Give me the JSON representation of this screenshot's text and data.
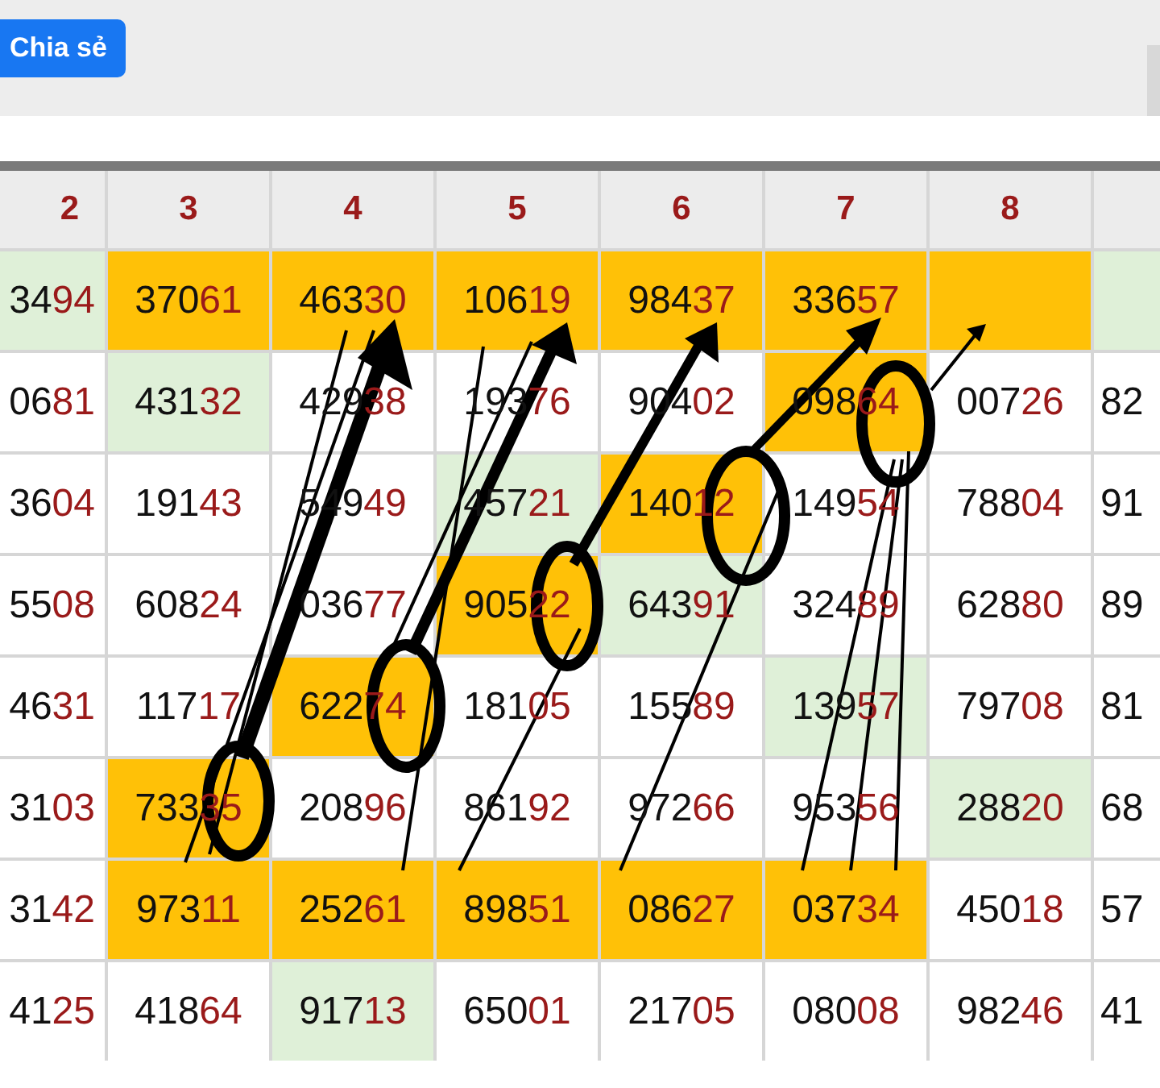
{
  "share_button": {
    "label": "Chia sẻ"
  },
  "table": {
    "columns": [
      "2",
      "3",
      "4",
      "5",
      "6",
      "7",
      "8",
      ""
    ],
    "rows": [
      [
        {
          "text": "3494",
          "color": "#dff0d8"
        },
        {
          "text": "37061",
          "color": "#ffc107"
        },
        {
          "text": "46330",
          "color": "#ffc107"
        },
        {
          "text": "10619",
          "color": "#ffc107"
        },
        {
          "text": "98437",
          "color": "#ffc107"
        },
        {
          "text": "33657",
          "color": "#ffc107"
        },
        {
          "text": "",
          "color": "#ffc107"
        },
        {
          "text": "",
          "color": "#dff0d8"
        }
      ],
      [
        {
          "text": "0681"
        },
        {
          "text": "43132",
          "color": "#dff0d8"
        },
        {
          "text": "42938"
        },
        {
          "text": "19376"
        },
        {
          "text": "90402"
        },
        {
          "text": "09864",
          "color": "#ffc107"
        },
        {
          "text": "00726"
        },
        {
          "text": "82"
        }
      ],
      [
        {
          "text": "3604"
        },
        {
          "text": "19143"
        },
        {
          "text": "54949"
        },
        {
          "text": "45721",
          "color": "#dff0d8"
        },
        {
          "text": "14012",
          "color": "#ffc107"
        },
        {
          "text": "14954"
        },
        {
          "text": "78804"
        },
        {
          "text": "91"
        }
      ],
      [
        {
          "text": "5508"
        },
        {
          "text": "60824"
        },
        {
          "text": "03677"
        },
        {
          "text": "90522",
          "color": "#ffc107"
        },
        {
          "text": "64391",
          "color": "#dff0d8"
        },
        {
          "text": "32489"
        },
        {
          "text": "62880"
        },
        {
          "text": "89"
        }
      ],
      [
        {
          "text": "4631"
        },
        {
          "text": "11717"
        },
        {
          "text": "62274",
          "color": "#ffc107"
        },
        {
          "text": "18105"
        },
        {
          "text": "15589"
        },
        {
          "text": "13957",
          "color": "#dff0d8"
        },
        {
          "text": "79708"
        },
        {
          "text": "81"
        }
      ],
      [
        {
          "text": "3103"
        },
        {
          "text": "73335",
          "color": "#ffc107"
        },
        {
          "text": "20896"
        },
        {
          "text": "86192"
        },
        {
          "text": "97266"
        },
        {
          "text": "95356"
        },
        {
          "text": "28820",
          "color": "#dff0d8"
        },
        {
          "text": "68"
        }
      ],
      [
        {
          "text": "3142"
        },
        {
          "text": "97311",
          "color": "#ffc107"
        },
        {
          "text": "25261",
          "color": "#ffc107"
        },
        {
          "text": "89851",
          "color": "#ffc107"
        },
        {
          "text": "08627",
          "color": "#ffc107"
        },
        {
          "text": "03734",
          "color": "#ffc107"
        },
        {
          "text": "45018"
        },
        {
          "text": "57"
        }
      ],
      [
        {
          "text": "4125"
        },
        {
          "text": "41864"
        },
        {
          "text": "91713",
          "color": "#dff0d8"
        },
        {
          "text": "65001"
        },
        {
          "text": "21705"
        },
        {
          "text": "08008"
        },
        {
          "text": "98246"
        },
        {
          "text": "41"
        }
      ]
    ]
  }
}
